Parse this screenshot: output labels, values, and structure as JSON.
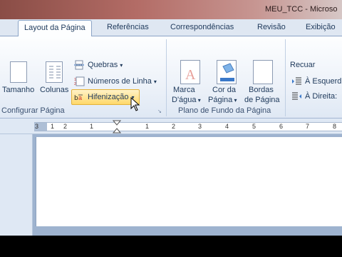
{
  "window": {
    "title": "MEU_TCC - Microso"
  },
  "tabs": [
    {
      "label": "Layout da Página",
      "active": true
    },
    {
      "label": "Referências"
    },
    {
      "label": "Correspondências"
    },
    {
      "label": "Revisão"
    },
    {
      "label": "Exibição"
    }
  ],
  "ribbon": {
    "configurar": {
      "group_label": "Configurar Página",
      "tamanho": "Tamanho",
      "colunas": "Colunas",
      "quebras": "Quebras",
      "numeros_linha": "Números de Linha",
      "hifenizacao": "Hifenização"
    },
    "plano_fundo": {
      "group_label": "Plano de Fundo da Página",
      "marca_line1": "Marca",
      "marca_line2": "D'água",
      "cor_line1": "Cor da",
      "cor_line2": "Página",
      "bordas_line1": "Bordas",
      "bordas_line2": "de Página"
    },
    "paragrafo": {
      "recuar": "Recuar",
      "esquerda": "À Esquerd",
      "direita": "À Direita:"
    }
  },
  "ruler": {
    "numbers": [
      "3",
      "1",
      "2",
      "1",
      "1",
      "2",
      "3",
      "4",
      "5",
      "6",
      "7",
      "8"
    ]
  },
  "colors": {
    "accent": "#ffd86a",
    "ribbon": "#edf2f9",
    "tab_text": "#1e395b"
  }
}
